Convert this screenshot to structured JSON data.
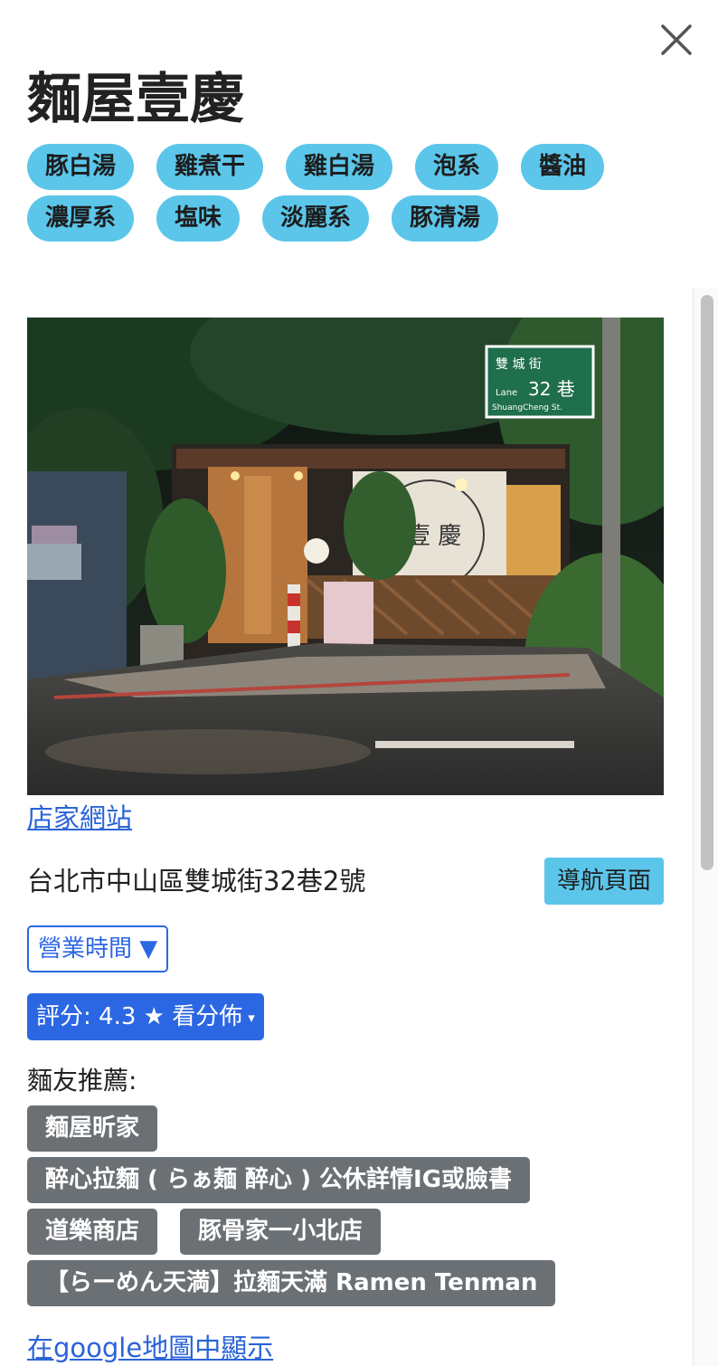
{
  "shop": {
    "name": "麵屋壹慶",
    "tags": [
      "豚白湯",
      "雞煮干",
      "雞白湯",
      "泡系",
      "醬油",
      "濃厚系",
      "塩味",
      "淡麗系",
      "豚清湯"
    ],
    "website_link": "店家網站",
    "address": "台北市中山區雙城街32巷2號",
    "navigate_button": "導航頁面",
    "hours_button": "營業時間 ▼",
    "rating_button": "評分: 4.3 ★ 看分佈",
    "rating_caret": "▾",
    "map_link": "在google地圖中顯示"
  },
  "photo": {
    "sign_chinese": "雙 城 街",
    "sign_lane": "Lane",
    "sign_number": "32 巷",
    "sign_street": "ShuangCheng St.",
    "curtain_text": "壹 慶"
  },
  "recommendations": {
    "label": "麵友推薦:",
    "items": [
      "麵屋昕家",
      "醉心拉麵 ( らぁ麺 醉心 ) 公休詳情IG或臉書",
      "道樂商店",
      "豚骨家一小北店",
      "【らーめん天満】拉麵天滿 Ramen Tenman"
    ]
  },
  "colors": {
    "tag_bg": "#5bc6ea",
    "primary_blue": "#2c67e3",
    "link_blue": "#2a63d8",
    "rec_bg": "#6b7075"
  },
  "icons": {
    "close": "close-icon"
  }
}
